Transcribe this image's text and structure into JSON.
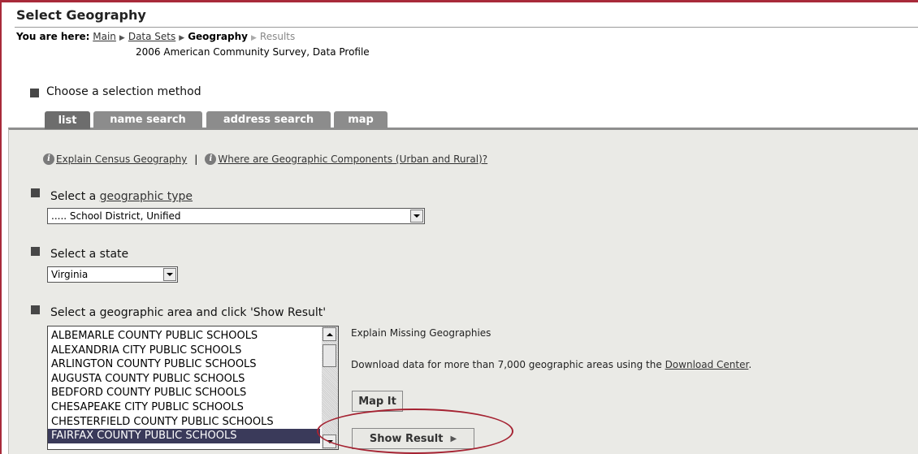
{
  "page": {
    "title": "Select Geography",
    "breadcrumb": {
      "label": "You are here:",
      "items": [
        "Main",
        "Data Sets",
        "Geography",
        "Results"
      ]
    },
    "subtitle": "2006 American Community Survey, Data Profile"
  },
  "method": {
    "heading": "Choose a selection method",
    "tabs": [
      "list",
      "name search",
      "address search",
      "map"
    ],
    "active_tab": "list"
  },
  "help_links": {
    "explain": "Explain Census Geography",
    "separator": "|",
    "components": "Where are Geographic Components (Urban and Rural)?"
  },
  "geo_type": {
    "label_prefix": "Select a",
    "label_link": "geographic type",
    "value": "..... School District, Unified"
  },
  "state": {
    "label": "Select a state",
    "value": "Virginia"
  },
  "area": {
    "label": "Select a geographic area and click 'Show Result'",
    "items": [
      "ALBEMARLE COUNTY PUBLIC SCHOOLS",
      "ALEXANDRIA CITY PUBLIC SCHOOLS",
      "ARLINGTON COUNTY PUBLIC SCHOOLS",
      "AUGUSTA COUNTY PUBLIC SCHOOLS",
      "BEDFORD COUNTY PUBLIC SCHOOLS",
      "CHESAPEAKE CITY PUBLIC SCHOOLS",
      "CHESTERFIELD COUNTY PUBLIC SCHOOLS",
      "FAIRFAX COUNTY PUBLIC SCHOOLS"
    ],
    "selected": "FAIRFAX COUNTY PUBLIC SCHOOLS"
  },
  "side": {
    "missing_link": "Explain Missing Geographies",
    "download_prefix": "Download data for more than 7,000 geographic areas using the",
    "download_link": "Download Center",
    "download_suffix": ".",
    "map_button": "Map It",
    "show_button": "Show Result",
    "show_arrow": "▶"
  },
  "colors": {
    "accent": "#a82a3a",
    "panel": "#eaeae6",
    "tab": "#8c8c8c",
    "highlight_circle": "#a52332"
  }
}
